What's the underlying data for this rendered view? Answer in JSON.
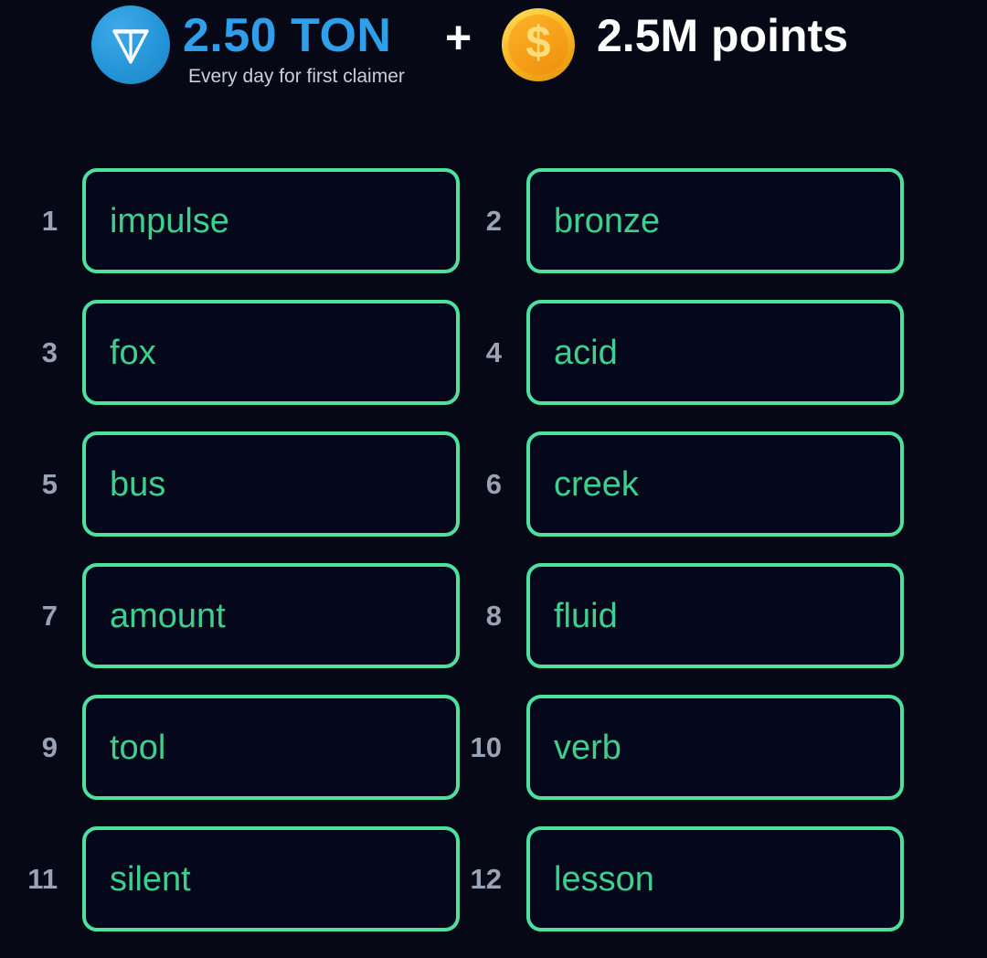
{
  "header": {
    "ton_icon": "ton-logo-icon",
    "ton_amount": "2.50 TON",
    "subtitle": "Every day for first claimer",
    "plus": "+",
    "coin_icon": "gold-coin-icon",
    "coin_symbol": "$",
    "points_amount": "2.5M points",
    "ton_color": "#2e9fe8",
    "points_color": "#ffffff"
  },
  "colors": {
    "background": "#060915",
    "box_border": "#4ee0a0",
    "box_fill": "#05081a",
    "word_text": "#3ecf8e",
    "index_text": "#9aa3b5"
  },
  "seed_phrase": {
    "rows": [
      {
        "left": {
          "index": "1",
          "word": "impulse"
        },
        "right": {
          "index": "2",
          "word": "bronze"
        }
      },
      {
        "left": {
          "index": "3",
          "word": "fox"
        },
        "right": {
          "index": "4",
          "word": "acid"
        }
      },
      {
        "left": {
          "index": "5",
          "word": "bus"
        },
        "right": {
          "index": "6",
          "word": "creek"
        }
      },
      {
        "left": {
          "index": "7",
          "word": "amount"
        },
        "right": {
          "index": "8",
          "word": "fluid"
        }
      },
      {
        "left": {
          "index": "9",
          "word": "tool"
        },
        "right": {
          "index": "10",
          "word": "verb"
        }
      },
      {
        "left": {
          "index": "11",
          "word": "silent"
        },
        "right": {
          "index": "12",
          "word": "lesson"
        }
      }
    ]
  }
}
